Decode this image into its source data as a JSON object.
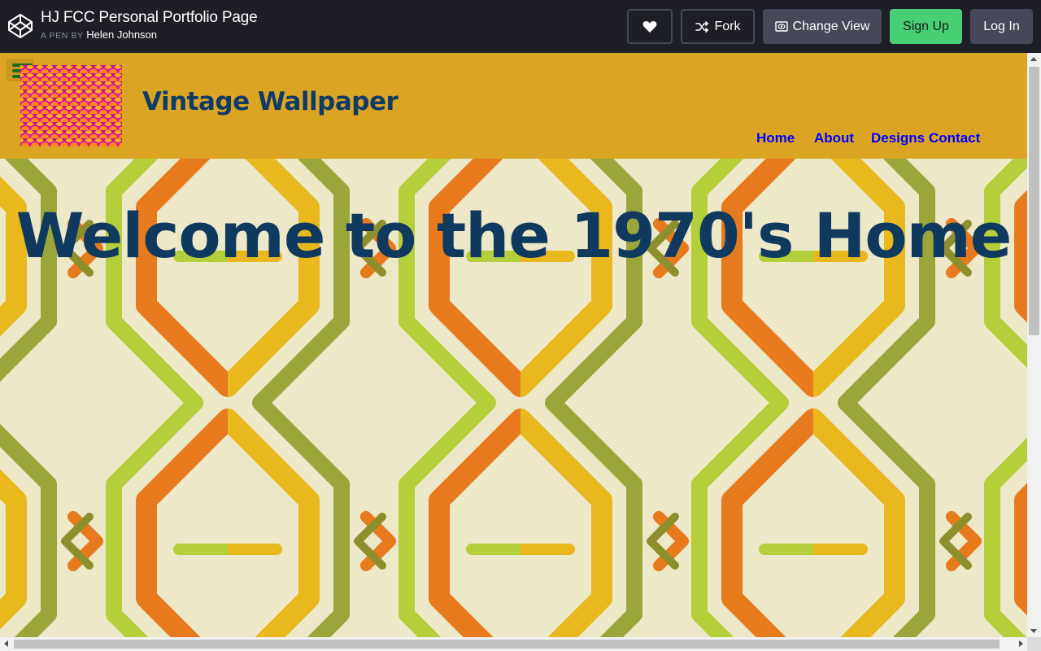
{
  "codepen": {
    "pen_title": "HJ FCC Personal Portfolio Page",
    "pen_by_label": "A PEN BY",
    "author": "Helen Johnson",
    "buttons": {
      "heart_icon": "heart-icon",
      "fork_label": "Fork",
      "fork_icon": "fork-icon",
      "change_view_label": "Change View",
      "change_view_icon": "eye-icon",
      "signup_label": "Sign Up",
      "login_label": "Log In"
    },
    "colors": {
      "bar_bg": "#1e1f26",
      "button_bg": "#444857",
      "signup_bg": "#47cf73"
    }
  },
  "site": {
    "menu_icon": "hamburger-icon",
    "brand": "Vintage Wallpaper",
    "nav": [
      "Home",
      "About",
      "Designs",
      "Contact"
    ],
    "hero_title": "Welcome to the 1970's Home",
    "colors": {
      "header_bg": "#dba523",
      "brand_text": "#0f3b66",
      "nav_link": "#0000ff",
      "hero_text": "#10395f"
    }
  }
}
